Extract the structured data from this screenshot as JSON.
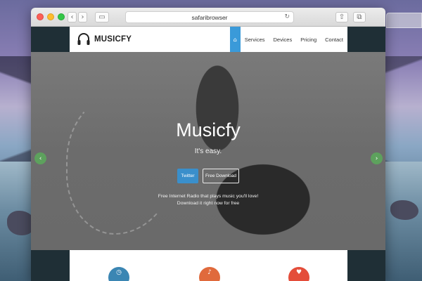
{
  "browser": {
    "address": "safaribrowser",
    "buttons": {
      "back": "‹",
      "forward": "›",
      "sidebar": "▭",
      "reload": "↻",
      "share": "⇧",
      "tabs": "⧉",
      "new_tab": "+"
    }
  },
  "site": {
    "logo_text": "MUSICFY",
    "nav": [
      {
        "label": "⌂",
        "icon": "home-icon",
        "active": true
      },
      {
        "label": "Services"
      },
      {
        "label": "Devices"
      },
      {
        "label": "Pricing"
      },
      {
        "label": "Contact"
      }
    ],
    "hero": {
      "title": "Musicfy",
      "subtitle": "It's easy.",
      "twitter_button": "Twitter",
      "download_button": "Free Download",
      "desc_line1": "Free Internet Radio that plays music you'll love!",
      "desc_line2": "Download it right now for free"
    },
    "carousel": {
      "prev": "‹",
      "next": "›"
    },
    "features": [
      {
        "icon": "feature-icon-1",
        "glyph": "◷"
      },
      {
        "icon": "feature-icon-2",
        "glyph": "♪"
      },
      {
        "icon": "feature-icon-3",
        "glyph": "♥"
      }
    ]
  },
  "colors": {
    "accent": "#3a9ad9",
    "twitter": "#3a8fcb",
    "carousel_arrow": "#5aaa5a"
  }
}
